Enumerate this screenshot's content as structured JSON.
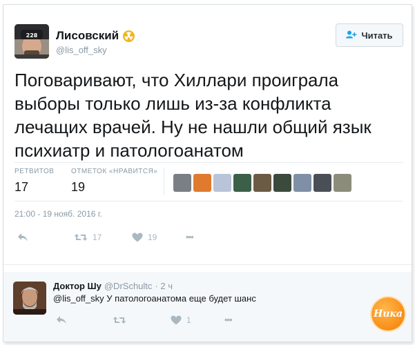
{
  "tweet": {
    "author_name": "Лисовский",
    "author_handle": "@lis_off_sky",
    "avatar_cap_text": "228",
    "follow_label": "Читать",
    "text": "Поговаривают, что Хиллари проиграла выборы только лишь из-за конфликта лечащих врачей. Ну не нашли общий язык психиатр и патологоанатом",
    "stats": {
      "retweets_label": "РЕТВИТОВ",
      "retweets_value": "17",
      "likes_label": "ОТМЕТОК «НРАВИТСЯ»",
      "likes_value": "19"
    },
    "likers": [
      "#7a7f86",
      "#e07a2f",
      "#b9c4d8",
      "#3c5f48",
      "#6b5a44",
      "#3a4a3c",
      "#7f8fa6",
      "#4a4f57",
      "#8c8c7a"
    ],
    "timestamp": "21:00 - 19 нояб. 2016 г.",
    "actions": {
      "reply_icon": "reply-icon",
      "retweet_icon": "retweet-icon",
      "retweet_count": "17",
      "like_icon": "heart-icon",
      "like_count": "19",
      "more_icon": "more-icon",
      "more_label": "•••"
    }
  },
  "reply": {
    "author_name": "Доктор Шу",
    "author_handle": "@DrSchultc",
    "time": "· 2 ч",
    "mention": "@lis_off_sky",
    "text": "У патологоанатома еще будет шанс",
    "actions": {
      "like_count": "1",
      "more_label": "•••"
    }
  },
  "watermark": "Ника",
  "colors": {
    "text_dark": "#14171a",
    "text_muted": "#8899a6",
    "icon_gray": "#aab8c2",
    "border": "#e6ecf0",
    "badge": "#f3b61f",
    "follow_blue": "#1da1f2"
  }
}
